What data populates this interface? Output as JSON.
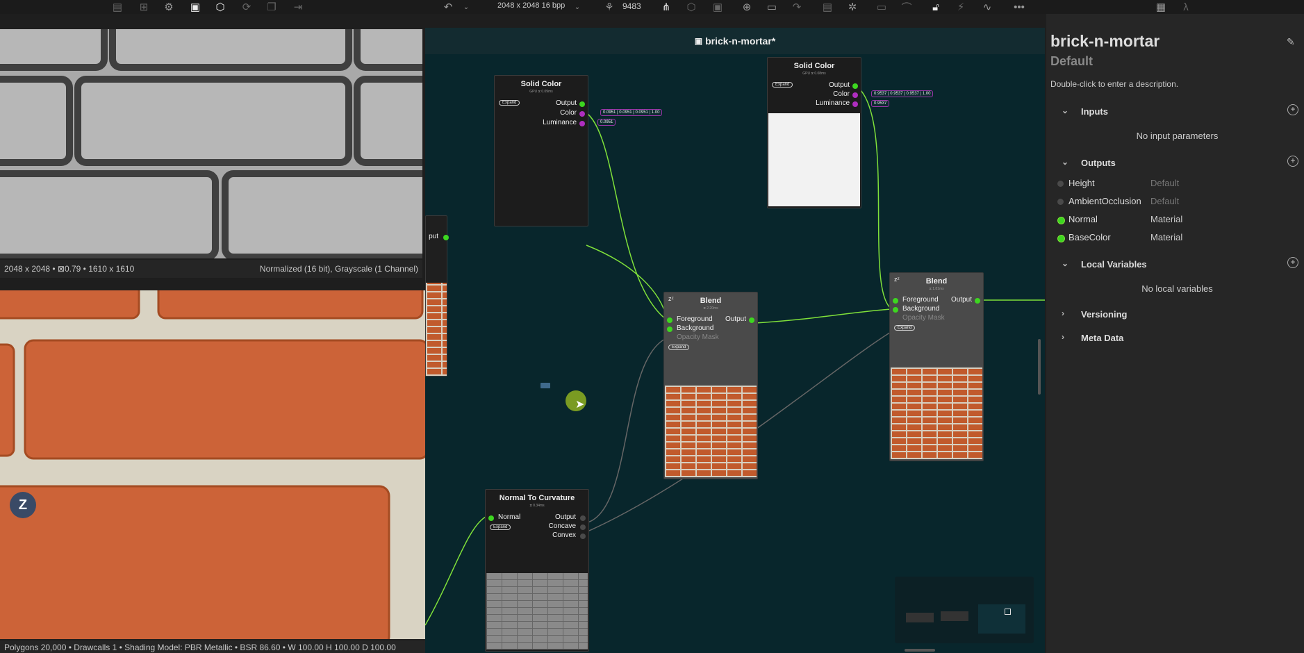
{
  "toolbar": {
    "resolution": "2048 x 2048 16 bpp",
    "seed": "9483"
  },
  "viewport2d": {
    "info_left": "2048 x 2048 • ⊠0.79 • 1610 x 1610",
    "info_right": "Normalized (16 bit), Grayscale (1 Channel)"
  },
  "viewport3d": {
    "status": "Polygons 20,000 • Drawcalls 1 • Shading Model: PBR Metallic • BSR 86.60 • W 100.00 H 100.00 D 100.00"
  },
  "graph": {
    "title": "brick-n-mortar*",
    "nodes": {
      "solid1": {
        "title": "Solid Color",
        "sub": "GPU ⧖ 0.09ms",
        "expand": "Expand",
        "ports": [
          "Output",
          "Color",
          "Luminance"
        ],
        "color_value": [
          "0.0951",
          "0.0951",
          "0.0951",
          "1.00"
        ],
        "lum_value": "0.0951"
      },
      "solid2": {
        "title": "Solid Color",
        "sub": "GPU ⧖ 0.08ms",
        "expand": "Expand",
        "ports": [
          "Output",
          "Color",
          "Luminance"
        ],
        "color_value": [
          "0.9537",
          "0.9537",
          "0.9537",
          "1.00"
        ],
        "lum_value": "0.9537"
      },
      "blend1": {
        "title": "Blend",
        "sub": "⧖ 2.20ms",
        "expand": "Expand",
        "inputs": [
          "Foreground",
          "Background",
          "Opacity Mask"
        ],
        "output": "Output"
      },
      "blend2": {
        "title": "Blend",
        "sub": "⧖ 1.81ms",
        "expand": "Expand",
        "inputs": [
          "Foreground",
          "Background",
          "Opacity Mask"
        ],
        "output": "Output"
      },
      "curv": {
        "title": "Normal To Curvature",
        "sub": "⧖ 0.34ms",
        "expand": "Expand",
        "input": "Normal",
        "outputs": [
          "Output",
          "Concave",
          "Convex"
        ]
      },
      "partial": {
        "output": "put"
      }
    }
  },
  "panel": {
    "title": "brick-n-mortar",
    "subtitle": "Default",
    "description": "Double-click to enter a description.",
    "inputs_label": "Inputs",
    "no_inputs": "No input parameters",
    "outputs_label": "Outputs",
    "outputs": [
      {
        "name": "Height",
        "type": "Default",
        "active": false
      },
      {
        "name": "AmbientOcclusion",
        "type": "Default",
        "active": false
      },
      {
        "name": "Normal",
        "type": "Material",
        "active": true
      },
      {
        "name": "BaseColor",
        "type": "Material",
        "active": true
      }
    ],
    "locals_label": "Local Variables",
    "no_locals": "No local variables",
    "versioning_label": "Versioning",
    "meta_label": "Meta Data"
  },
  "colors": {
    "graph_bg": "#08262c",
    "link": "#7fe03a",
    "port_green": "#3dd620",
    "port_purple": "#b02ec0",
    "brick": "#c15a2c"
  }
}
